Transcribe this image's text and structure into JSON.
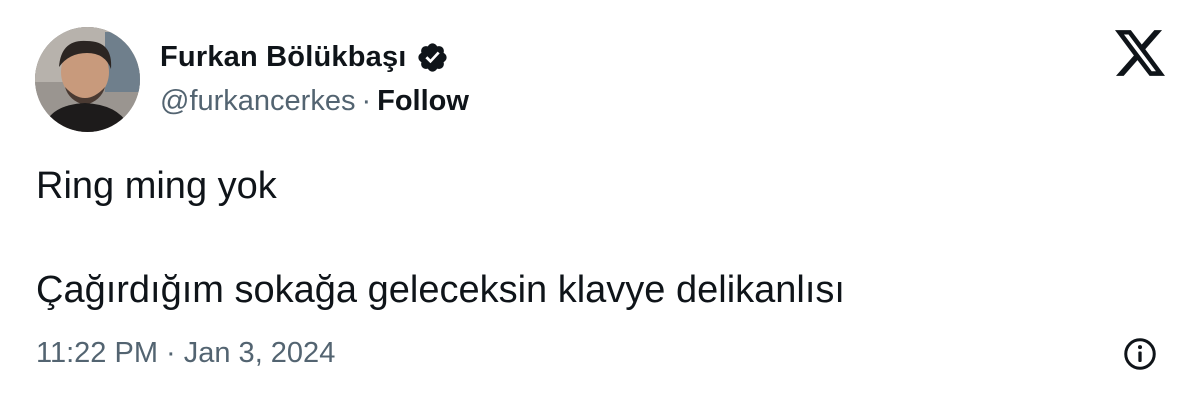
{
  "author": {
    "display_name": "Furkan Bölükbaşı",
    "handle": "@furkancerkes",
    "separator": "·",
    "follow_label": "Follow",
    "verified": true,
    "avatar_icon": "profile-photo"
  },
  "tweet": {
    "paragraphs": [
      "Ring ming yok",
      "Çağırdığım sokağa geleceksin klavye delikanlısı"
    ],
    "timestamp": "11:22 PM · Jan 3, 2024"
  },
  "icons": {
    "brand": "x-logo-icon",
    "verified": "verified-badge-icon",
    "info": "info-icon"
  },
  "colors": {
    "text_primary": "#0f1419",
    "text_secondary": "#536471",
    "background": "#ffffff"
  }
}
